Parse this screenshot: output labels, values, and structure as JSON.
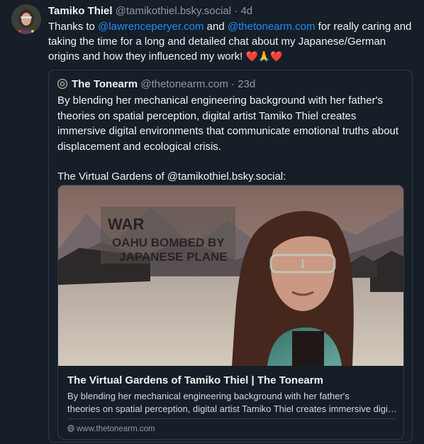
{
  "post": {
    "author_name": "Tamiko Thiel",
    "author_handle": "@tamikothiel.bsky.social",
    "separator": "·",
    "age": "4d",
    "text_before_1": "Thanks to ",
    "mention_1": "@lawrenceperyer.com",
    "text_between": " and ",
    "mention_2": "@thetonearm.com",
    "text_after": " for really caring and taking the time for a long and detailed chat about my Japanese/German origins and how they influenced my work! ",
    "emojis": "❤️🙏❤️"
  },
  "quote": {
    "author_name": "The Tonearm",
    "author_handle": "@thetonearm.com",
    "separator": "·",
    "age": "23d",
    "paragraph_1": "By blending her mechanical engineering background with her father's theories on spatial perception, digital artist Tamiko Thiel creates immersive digital environments that communicate emotional truths about displacement and ecological crisis.",
    "paragraph_2": "The Virtual Gardens of @tamikothiel.bsky.social:"
  },
  "card": {
    "image_sign_line_1": "OAHU BOMBED BY",
    "image_sign_line_2": "JAPANESE PLANE",
    "image_sign_word": "WAR",
    "title": "The Virtual Gardens of Tamiko Thiel | The Tonearm",
    "description_line_1": "By blending her mechanical engineering background with her father's",
    "description_line_2": "theories on spatial perception, digital artist Tamiko Thiel creates immersive digital environments that communicate emotional truths",
    "domain": "www.thetonearm.com"
  },
  "colors": {
    "background": "#161e27",
    "mention": "#208bfe",
    "muted": "#8d9aab",
    "border": "#2e3b4b"
  }
}
